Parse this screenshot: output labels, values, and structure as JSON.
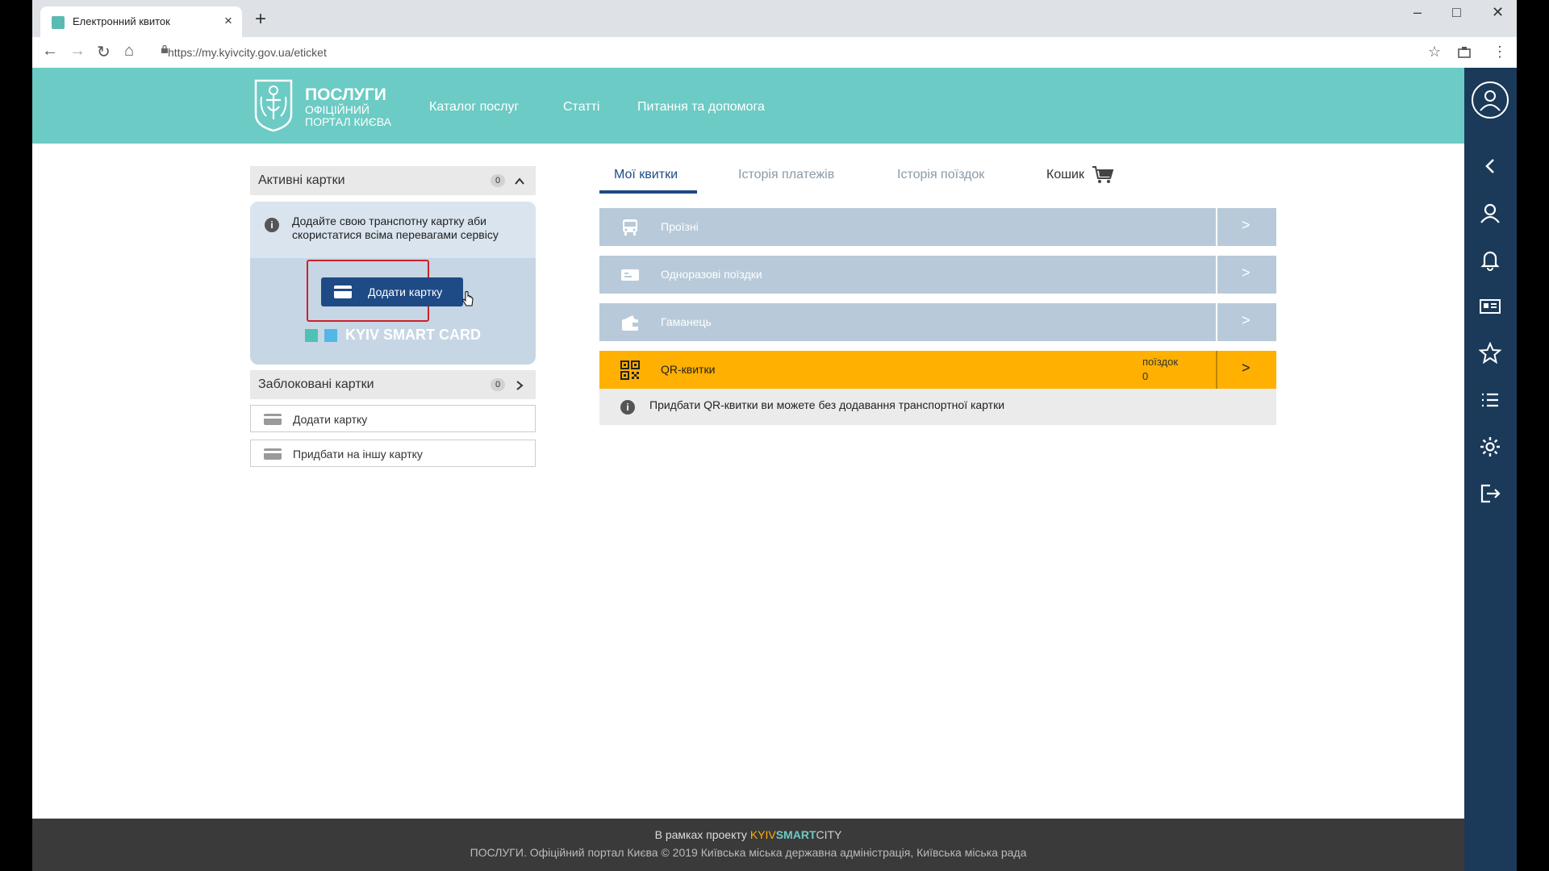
{
  "browser": {
    "tab_title": "Електронний квиток",
    "tab_close": "×",
    "new_tab": "+",
    "url": "https://my.kyivcity.gov.ua/eticket",
    "win_min": "–",
    "win_max": "□",
    "win_close": "✕",
    "back": "←",
    "forward": "→",
    "reload": "↻",
    "home": "⌂",
    "bookmark": "☆",
    "menu": "⋮"
  },
  "header": {
    "logo_line1": "ПОСЛУГИ",
    "logo_line2": "ОФІЦІЙНИЙ",
    "logo_line3": "ПОРТАЛ КИЄВА",
    "nav": [
      "Каталог послуг",
      "Статті",
      "Питання та допомога"
    ]
  },
  "left": {
    "active_title": "Активні картки",
    "active_count": "0",
    "active_chevron": "^",
    "promo_text": "Додайте свою транспотну картку аби скористатися всіма перевагами сервісу",
    "promo_info": "i",
    "add_card_primary": "Додати картку",
    "ksc_label": "KYIV SMART CARD",
    "blocked_title": "Заблоковані картки",
    "blocked_count": "0",
    "blocked_chevron": ">",
    "add_card": "Додати картку",
    "buy_other": "Придбати на іншу картку"
  },
  "tabs": {
    "items": [
      "Мої квитки",
      "Історія платежів",
      "Історія поїздок",
      "Кошик"
    ]
  },
  "rows": [
    {
      "label": "Проїзні",
      "icon": "bus-icon"
    },
    {
      "label": "Одноразові поїздки",
      "icon": "single-ride-icon"
    },
    {
      "label": "Гаманець",
      "icon": "wallet-icon"
    },
    {
      "label": "QR-квитки",
      "icon": "qr-code-icon",
      "sub1": "поїздок",
      "sub2": "0"
    }
  ],
  "row_arrow": ">",
  "qr_note": "Придбати QR-квитки ви можете без додавання транспортної картки",
  "qr_note_info": "i",
  "footer": {
    "line1_prefix": "В рамках проекту ",
    "brand_kyiv": "KYIV",
    "brand_smart": "SMART",
    "brand_city": "CITY",
    "line2": "ПОСЛУГИ. Офіційний портал Києва © 2019 Київська міська державна адміністрація, Київська міська рада"
  },
  "colors": {
    "header": "#6ccbc4",
    "sidebar": "#1b3a5a",
    "primary": "#1e4a86",
    "qr_row": "#ffb000",
    "ticket_row": "#b8cad9"
  }
}
